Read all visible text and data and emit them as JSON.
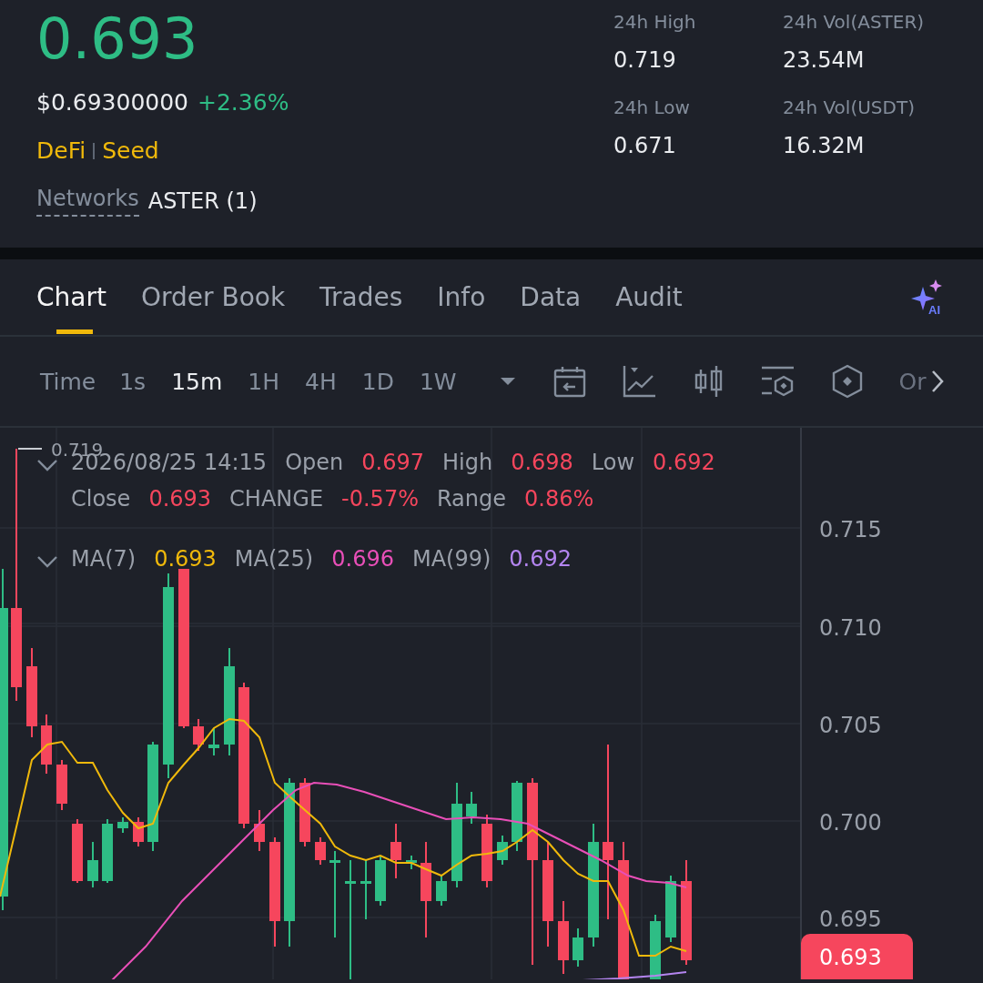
{
  "price": {
    "last": "0.693",
    "usd": "$0.69300000",
    "change": "+2.36%"
  },
  "tags": [
    "DeFi",
    "Seed"
  ],
  "networks": {
    "label": "Networks",
    "value": "ASTER (1)"
  },
  "stats": [
    {
      "label": "24h High",
      "value": "0.719"
    },
    {
      "label": "24h Vol(ASTER)",
      "value": "23.54M"
    },
    {
      "label": "24h Low",
      "value": "0.671"
    },
    {
      "label": "24h Vol(USDT)",
      "value": "16.32M"
    }
  ],
  "ai_badge": "AI",
  "tabs": [
    {
      "label": "Chart",
      "selected": true
    },
    {
      "label": "Order Book",
      "selected": false
    },
    {
      "label": "Trades",
      "selected": false
    },
    {
      "label": "Info",
      "selected": false
    },
    {
      "label": "Data",
      "selected": false
    },
    {
      "label": "Audit",
      "selected": false
    }
  ],
  "toolbar": {
    "time_label": "Time",
    "intervals": [
      {
        "label": "1s",
        "selected": false
      },
      {
        "label": "15m",
        "selected": true
      },
      {
        "label": "1H",
        "selected": false
      },
      {
        "label": "4H",
        "selected": false
      },
      {
        "label": "1D",
        "selected": false
      },
      {
        "label": "1W",
        "selected": false
      }
    ],
    "more": "Or"
  },
  "chart": {
    "high_marker": "0.719",
    "timestamp": "2026/08/25 14:15",
    "ohlc": [
      {
        "label": "Open",
        "value": "0.697"
      },
      {
        "label": "High",
        "value": "0.698"
      },
      {
        "label": "Low",
        "value": "0.692"
      },
      {
        "label": "Close",
        "value": "0.693"
      },
      {
        "label": "CHANGE",
        "value": "-0.57%"
      },
      {
        "label": "Range",
        "value": "0.86%"
      }
    ],
    "moving_averages": [
      {
        "label": "MA(7)",
        "value": "0.693",
        "color": "#f0b90b"
      },
      {
        "label": "MA(25)",
        "value": "0.696",
        "color": "#e94fb8"
      },
      {
        "label": "MA(99)",
        "value": "0.692",
        "color": "#b485f0"
      }
    ],
    "y_ticks": [
      "0.715",
      "0.710",
      "0.705",
      "0.700",
      "0.695"
    ],
    "price_tag": "0.693"
  }
}
